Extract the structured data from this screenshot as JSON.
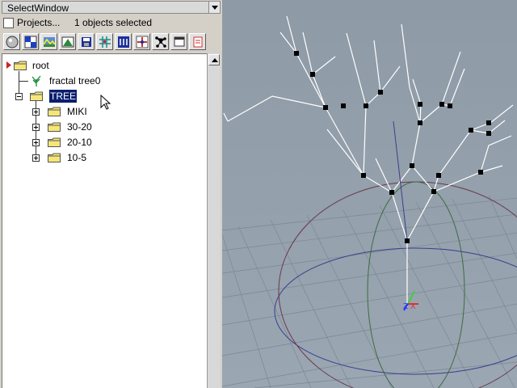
{
  "window": {
    "title": "SelectWindow"
  },
  "info": {
    "projects_label": "Projects...",
    "selection_status": "1 objects selected"
  },
  "toolbar": {
    "buttons": [
      "sphere-icon",
      "checker-icon",
      "landscape-icon",
      "mountain-icon",
      "save-icon",
      "grid-icon",
      "filter-icon",
      "cross-icon",
      "nodes-icon",
      "window-icon",
      "copy-icon"
    ]
  },
  "tree": {
    "root_label": "root",
    "fractal_label": "fractal tree0",
    "tree_label": "TREE",
    "children": [
      "MIKI",
      "30-20",
      "20-10",
      "10-5"
    ]
  },
  "colors": {
    "panel_bg": "#d4d0c8",
    "selection_bg": "#0a1e6e",
    "viewport_bg": "#8e9aa6",
    "folder_yellow": "#f5e67a"
  }
}
